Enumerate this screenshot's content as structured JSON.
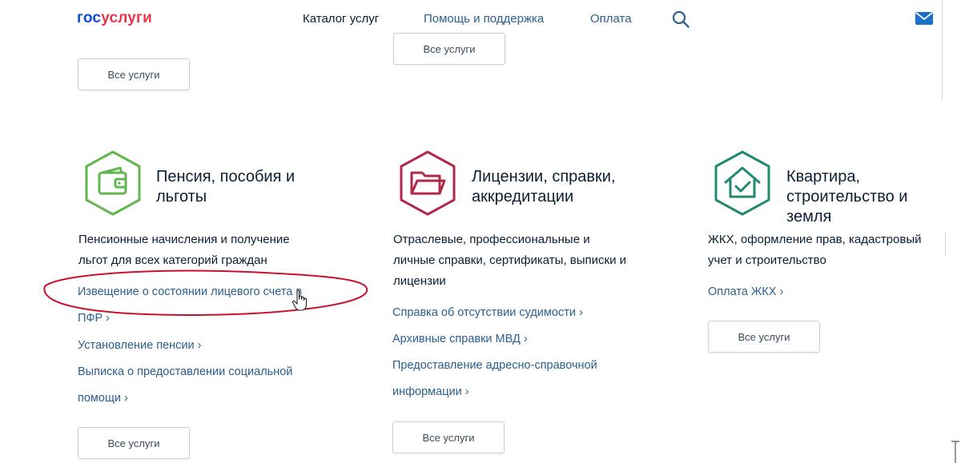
{
  "header": {
    "logo_part1": "гос",
    "logo_part2": "услуги",
    "nav": [
      "Каталог услуг",
      "Помощь и поддержка",
      "Оплата"
    ],
    "search_icon": "search-icon",
    "mail_icon": "mail-icon"
  },
  "top_buttons": [
    "Все услуги",
    "Все услуги"
  ],
  "categories": [
    {
      "icon": "wallet-icon",
      "color": "#62b64f",
      "title": [
        "Пенсия, пособия и",
        "льготы"
      ],
      "desc": [
        "Пенсионные начисления и получение",
        "льгот для всех категорий граждан"
      ],
      "links": [
        "Извещение о состоянии лицевого счета в",
        "ПФР ›",
        "Установление пенсии ›",
        "Выписка о предоставлении социальной",
        "помощи ›"
      ],
      "button": "Все услуги"
    },
    {
      "icon": "folder-icon",
      "color": "#b0294a",
      "title": [
        "Лицензии, справки,",
        "аккредитации"
      ],
      "desc": [
        "Отраслевые, профессиональные и",
        "личные справки, сертификаты, выписки и",
        "лицензии"
      ],
      "links": [
        "Справка об отсутствии судимости ›",
        "Архивные справки МВД ›",
        "Предоставление адресно-справочной",
        "информации ›"
      ],
      "button": "Все услуги"
    },
    {
      "icon": "house-check-icon",
      "color": "#1f8a6e",
      "title": [
        "Квартира,",
        "строительство и",
        "земля"
      ],
      "desc": [
        "ЖКХ, оформление прав, кадастровый",
        "учет и строительство"
      ],
      "links": [
        "Оплата ЖКХ ›"
      ],
      "button": "Все услуги"
    }
  ],
  "annotation_color": "#c8102e"
}
